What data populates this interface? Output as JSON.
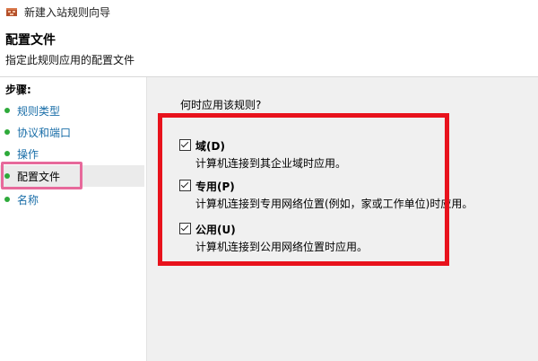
{
  "window": {
    "title": "新建入站规则向导",
    "app_icon": "firewall-shield-icon"
  },
  "header": {
    "title": "配置文件",
    "subtitle": "指定此规则应用的配置文件"
  },
  "sidebar": {
    "heading": "步骤:",
    "items": [
      {
        "label": "规则类型",
        "active": false
      },
      {
        "label": "协议和端口",
        "active": false
      },
      {
        "label": "操作",
        "active": false
      },
      {
        "label": "配置文件",
        "active": true
      },
      {
        "label": "名称",
        "active": false
      }
    ]
  },
  "content": {
    "question": "何时应用该规则?",
    "options": [
      {
        "label": "域(D)",
        "description": "计算机连接到其企业域时应用。",
        "checked": true
      },
      {
        "label": "专用(P)",
        "description": "计算机连接到专用网络位置(例如，家或工作单位)时应用。",
        "checked": true
      },
      {
        "label": "公用(U)",
        "description": "计算机连接到公用网络位置时应用。",
        "checked": true
      }
    ]
  },
  "colors": {
    "annotation_red": "#e8121c",
    "annotation_pink": "#e7699b",
    "step_link": "#1a6ea8",
    "step_dot": "#2eaa3a"
  }
}
